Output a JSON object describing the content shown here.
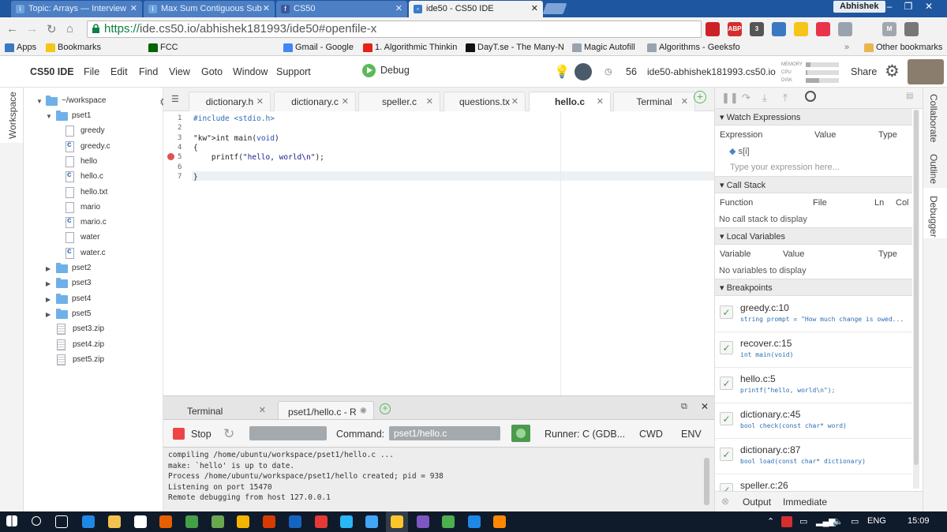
{
  "browser": {
    "tabs": [
      {
        "title": "Topic: Arrays — Interview",
        "icon": "interviewbit-icon",
        "active": false
      },
      {
        "title": "Max Sum Contiguous Sub",
        "icon": "interviewbit-icon",
        "active": false
      },
      {
        "title": "CS50",
        "icon": "facebook-icon",
        "active": false
      },
      {
        "title": "ide50 - CS50 IDE",
        "icon": "cs50-icon",
        "active": true
      }
    ],
    "user": "Abhishek",
    "url_scheme": "https://",
    "url_rest": "ide.cs50.io/abhishek181993/ide50#openfile-x",
    "extensions": [
      {
        "name": "pinterest-icon",
        "color": "#cc2127",
        "text": ""
      },
      {
        "name": "adblock-icon",
        "color": "#d32f2f",
        "text": "ABP"
      },
      {
        "name": "extension-badge-icon",
        "color": "#555555",
        "text": "3"
      },
      {
        "name": "screen-icon",
        "color": "#3b78c2",
        "text": ""
      },
      {
        "name": "star-icon",
        "color": "#f5c518",
        "text": ""
      },
      {
        "name": "pocket-icon",
        "color": "#e8334a",
        "text": ""
      },
      {
        "name": "mail-icon",
        "color": "#9aa3ad",
        "text": ""
      },
      {
        "name": "bookmark-star-icon",
        "color": "#f2f2f2",
        "text": ""
      },
      {
        "name": "m-icon",
        "color": "#a0a7ae",
        "text": "M"
      },
      {
        "name": "menu-icon",
        "color": "#777777",
        "text": ""
      }
    ],
    "bookmarks": [
      {
        "label": "Apps",
        "icon": "apps-icon",
        "color": "#3b78c2"
      },
      {
        "label": "Bookmarks",
        "icon": "star-icon",
        "color": "#f5c518"
      },
      {
        "label": "",
        "icon": "facebook-icon",
        "color": "#3b5998"
      },
      {
        "label": "",
        "icon": "reader-icon",
        "color": "#b0413e"
      },
      {
        "label": "FCC",
        "icon": "fcc-icon",
        "color": "#006400"
      },
      {
        "label": "",
        "icon": "youtube-icon",
        "color": "#e62117"
      },
      {
        "label": "",
        "icon": "google-icon",
        "color": "#4285f4"
      },
      {
        "label": "",
        "icon": "spider-icon",
        "color": "#222222"
      },
      {
        "label": "",
        "icon": "va-icon",
        "color": "#111111"
      },
      {
        "label": "",
        "icon": "t-icon",
        "color": "#2a6fb8"
      },
      {
        "label": "Gmail - Google",
        "icon": "google-icon",
        "color": "#4285f4"
      },
      {
        "label": "1. Algorithmic Thinkin",
        "icon": "youtube-icon",
        "color": "#e62117"
      },
      {
        "label": "DayT.se - The Many-N",
        "icon": "m-logo-icon",
        "color": "#111111"
      },
      {
        "label": "Magic Autofill",
        "icon": "page-icon",
        "color": "#9aa3ad"
      },
      {
        "label": "Algorithms - Geeksfo",
        "icon": "page-icon",
        "color": "#9aa3ad"
      }
    ],
    "other_bookmarks": "Other bookmarks"
  },
  "ide": {
    "title": "CS50 IDE",
    "menu": [
      "File",
      "Edit",
      "Find",
      "View",
      "Goto",
      "Window",
      "Support"
    ],
    "debug_label": "Debug",
    "counter": "56",
    "workspace_name": "ide50-abhishek181993.cs50.io",
    "meters": [
      {
        "label": "MEMORY",
        "level": 0.15
      },
      {
        "label": "CPU",
        "level": 0.05
      },
      {
        "label": "DISK",
        "level": 0.4
      }
    ],
    "share_label": "Share",
    "left_strip_label": "Workspace",
    "right_strip_labels": [
      "Collaborate",
      "Outline",
      "Debugger"
    ]
  },
  "tree": {
    "root": "~/workspace",
    "nodes": [
      {
        "label": "pset1",
        "type": "folder",
        "depth": 1,
        "expanded": true
      },
      {
        "label": "greedy",
        "type": "file",
        "depth": 2
      },
      {
        "label": "greedy.c",
        "type": "c",
        "depth": 2
      },
      {
        "label": "hello",
        "type": "file",
        "depth": 2
      },
      {
        "label": "hello.c",
        "type": "c",
        "depth": 2
      },
      {
        "label": "hello.txt",
        "type": "file",
        "depth": 2
      },
      {
        "label": "mario",
        "type": "file",
        "depth": 2
      },
      {
        "label": "mario.c",
        "type": "c",
        "depth": 2
      },
      {
        "label": "water",
        "type": "file",
        "depth": 2
      },
      {
        "label": "water.c",
        "type": "c",
        "depth": 2
      },
      {
        "label": "pset2",
        "type": "folder",
        "depth": 1,
        "expanded": false
      },
      {
        "label": "pset3",
        "type": "folder",
        "depth": 1,
        "expanded": false
      },
      {
        "label": "pset4",
        "type": "folder",
        "depth": 1,
        "expanded": false
      },
      {
        "label": "pset5",
        "type": "folder",
        "depth": 1,
        "expanded": false
      },
      {
        "label": "pset3.zip",
        "type": "zip",
        "depth": 1
      },
      {
        "label": "pset4.zip",
        "type": "zip",
        "depth": 1
      },
      {
        "label": "pset5.zip",
        "type": "zip",
        "depth": 1
      }
    ]
  },
  "editor": {
    "tabs": [
      "dictionary.h",
      "dictionary.c",
      "speller.c",
      "questions.tx",
      "hello.c",
      "Terminal"
    ],
    "active_tab": 4,
    "lines": [
      {
        "n": "1",
        "text": "#include <stdio.h>"
      },
      {
        "n": "2",
        "text": ""
      },
      {
        "n": "3",
        "text": "int main(void)"
      },
      {
        "n": "4",
        "text": "{"
      },
      {
        "n": "5",
        "text": "    printf(\"hello, world\\n\");"
      },
      {
        "n": "6",
        "text": ""
      },
      {
        "n": "7",
        "text": "}"
      }
    ]
  },
  "panel": {
    "tabs": [
      "Terminal",
      "pset1/hello.c - R"
    ],
    "stop_label": "Stop",
    "command_label": "Command:",
    "command_value": "pset1/hello.c",
    "runner_label": "Runner: C (GDB...",
    "cwd_label": "CWD",
    "env_label": "ENV",
    "output": [
      "compiling /home/ubuntu/workspace/pset1/hello.c ...",
      "make: `hello' is up to date.",
      "Process /home/ubuntu/workspace/pset1/hello created; pid = 938",
      "Listening on port 15470",
      "Remote debugging from host 127.0.0.1",
      ""
    ]
  },
  "debugger": {
    "watch": {
      "title": "Watch Expressions",
      "cols": [
        "Expression",
        "Value",
        "Type"
      ],
      "items": [
        "s[i]"
      ],
      "placeholder": "Type your expression here..."
    },
    "callstack": {
      "title": "Call Stack",
      "cols": [
        "Function",
        "File",
        "Ln",
        "Col"
      ],
      "empty": "No call stack to display"
    },
    "locals": {
      "title": "Local Variables",
      "cols": [
        "Variable",
        "Value",
        "Type"
      ],
      "empty": "No variables to display"
    },
    "breakpoints": {
      "title": "Breakpoints",
      "items": [
        {
          "loc": "greedy.c:10",
          "code": "string prompt = \"How much change is owed..."
        },
        {
          "loc": "recover.c:15",
          "code": "int main(void)"
        },
        {
          "loc": "hello.c:5",
          "code": "printf(\"hello, world\\n\");"
        },
        {
          "loc": "dictionary.c:45",
          "code": "bool check(const char* word)"
        },
        {
          "loc": "dictionary.c:87",
          "code": "bool load(const char* dictionary)"
        },
        {
          "loc": "speller.c:26",
          "code": ""
        }
      ]
    },
    "footer": [
      "Output",
      "Immediate"
    ]
  },
  "taskbar": {
    "apps": [
      {
        "name": "windows-start-icon",
        "color": "#ffffff"
      },
      {
        "name": "search-icon",
        "color": "#ffffff"
      },
      {
        "name": "task-view-icon",
        "color": "#ffffff"
      },
      {
        "name": "edge-icon",
        "color": "#1e88e5"
      },
      {
        "name": "file-explorer-icon",
        "color": "#f2c14e"
      },
      {
        "name": "store-icon",
        "color": "#ffffff"
      },
      {
        "name": "firefox-icon",
        "color": "#e66000"
      },
      {
        "name": "app-green-icon",
        "color": "#43a047"
      },
      {
        "name": "globe-icon",
        "color": "#6aa84f"
      },
      {
        "name": "notes-icon",
        "color": "#f4b400"
      },
      {
        "name": "office-icon",
        "color": "#d83b01"
      },
      {
        "name": "news-icon",
        "color": "#1565c0"
      },
      {
        "name": "paint-icon",
        "color": "#e53935"
      },
      {
        "name": "star-app-icon",
        "color": "#29b6f6"
      },
      {
        "name": "people-icon",
        "color": "#42a5f5"
      },
      {
        "name": "chrome-icon",
        "color": "#fbbc05"
      },
      {
        "name": "dev-icon",
        "color": "#7e57c2"
      },
      {
        "name": "utorrent-icon",
        "color": "#4caf50"
      },
      {
        "name": "settings-app-icon",
        "color": "#1e88e5"
      },
      {
        "name": "vlc-icon",
        "color": "#ff8800"
      }
    ],
    "lang": "ENG",
    "time": "15:09"
  }
}
